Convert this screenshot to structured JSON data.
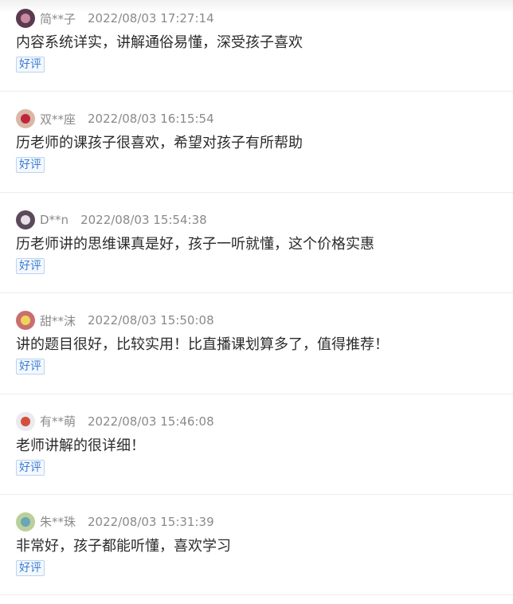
{
  "reviews": [
    {
      "user": "简**子",
      "time": "2022/08/03 17:27:14",
      "content": "内容系统详实，讲解通俗易懂，深受孩子喜欢",
      "tag": "好评",
      "avatar_colors": [
        "#5a3a50",
        "#c98aa0"
      ]
    },
    {
      "user": "双**座",
      "time": "2022/08/03 16:15:54",
      "content": "历老师的课孩子很喜欢，希望对孩子有所帮助",
      "tag": "好评",
      "avatar_colors": [
        "#d9b8a8",
        "#c0263b"
      ]
    },
    {
      "user": "D**n",
      "time": "2022/08/03 15:54:38",
      "content": "历老师讲的思维课真是好，孩子一听就懂，这个价格实惠",
      "tag": "好评",
      "avatar_colors": [
        "#5b4a5a",
        "#e8e0e4"
      ]
    },
    {
      "user": "甜**沫",
      "time": "2022/08/03 15:50:08",
      "content": "讲的题目很好，比较实用！比直播课划算多了，值得推荐！",
      "tag": "好评",
      "avatar_colors": [
        "#c96f6f",
        "#f2d35a"
      ]
    },
    {
      "user": "有**萌",
      "time": "2022/08/03 15:46:08",
      "content": "老师讲解的很详细！",
      "tag": "好评",
      "avatar_colors": [
        "#eaeaf0",
        "#d4503a"
      ]
    },
    {
      "user": "朱**珠",
      "time": "2022/08/03 15:31:39",
      "content": "非常好，孩子都能听懂，喜欢学习",
      "tag": "好评",
      "avatar_colors": [
        "#b9d09a",
        "#6aa6b8"
      ]
    }
  ]
}
